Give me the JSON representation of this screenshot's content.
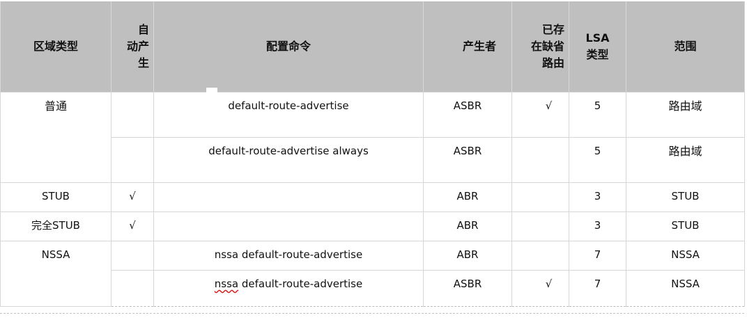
{
  "table": {
    "headers": {
      "area_type": "区域类型",
      "auto_gen_l1": "自",
      "auto_gen_l2": "动产",
      "auto_gen_l3": "生",
      "command": "配置命令",
      "producer": "产生者",
      "existing_default_l1": "已存",
      "existing_default_l2": "在缺省",
      "existing_default_l3": "路由",
      "lsa_type_l1": "LSA",
      "lsa_type_l2": "类型",
      "scope": "范围"
    },
    "rows": [
      {
        "area": "普通",
        "auto": "",
        "command": "default-route-advertise",
        "producer": "ASBR",
        "existing": "√",
        "lsa": "5",
        "scope": "路由域"
      },
      {
        "area": "",
        "auto": "",
        "command": "default-route-advertise always",
        "producer": "ASBR",
        "existing": "",
        "lsa": "5",
        "scope": "路由域"
      },
      {
        "area": "STUB",
        "auto": "√",
        "command": "",
        "producer": "ABR",
        "existing": "",
        "lsa": "3",
        "scope": "STUB"
      },
      {
        "area": "完全STUB",
        "auto": "√",
        "command": "",
        "producer": "ABR",
        "existing": "",
        "lsa": "3",
        "scope": "STUB"
      },
      {
        "area": "NSSA",
        "auto": "",
        "command": "nssa default-route-advertise",
        "producer": "ABR",
        "existing": "",
        "lsa": "7",
        "scope": "NSSA"
      },
      {
        "area": "",
        "auto": "",
        "command_part1": "nssa",
        "command_part2": " default-route-advertise",
        "producer": "ASBR",
        "existing": "√",
        "lsa": "7",
        "scope": "NSSA"
      }
    ]
  }
}
